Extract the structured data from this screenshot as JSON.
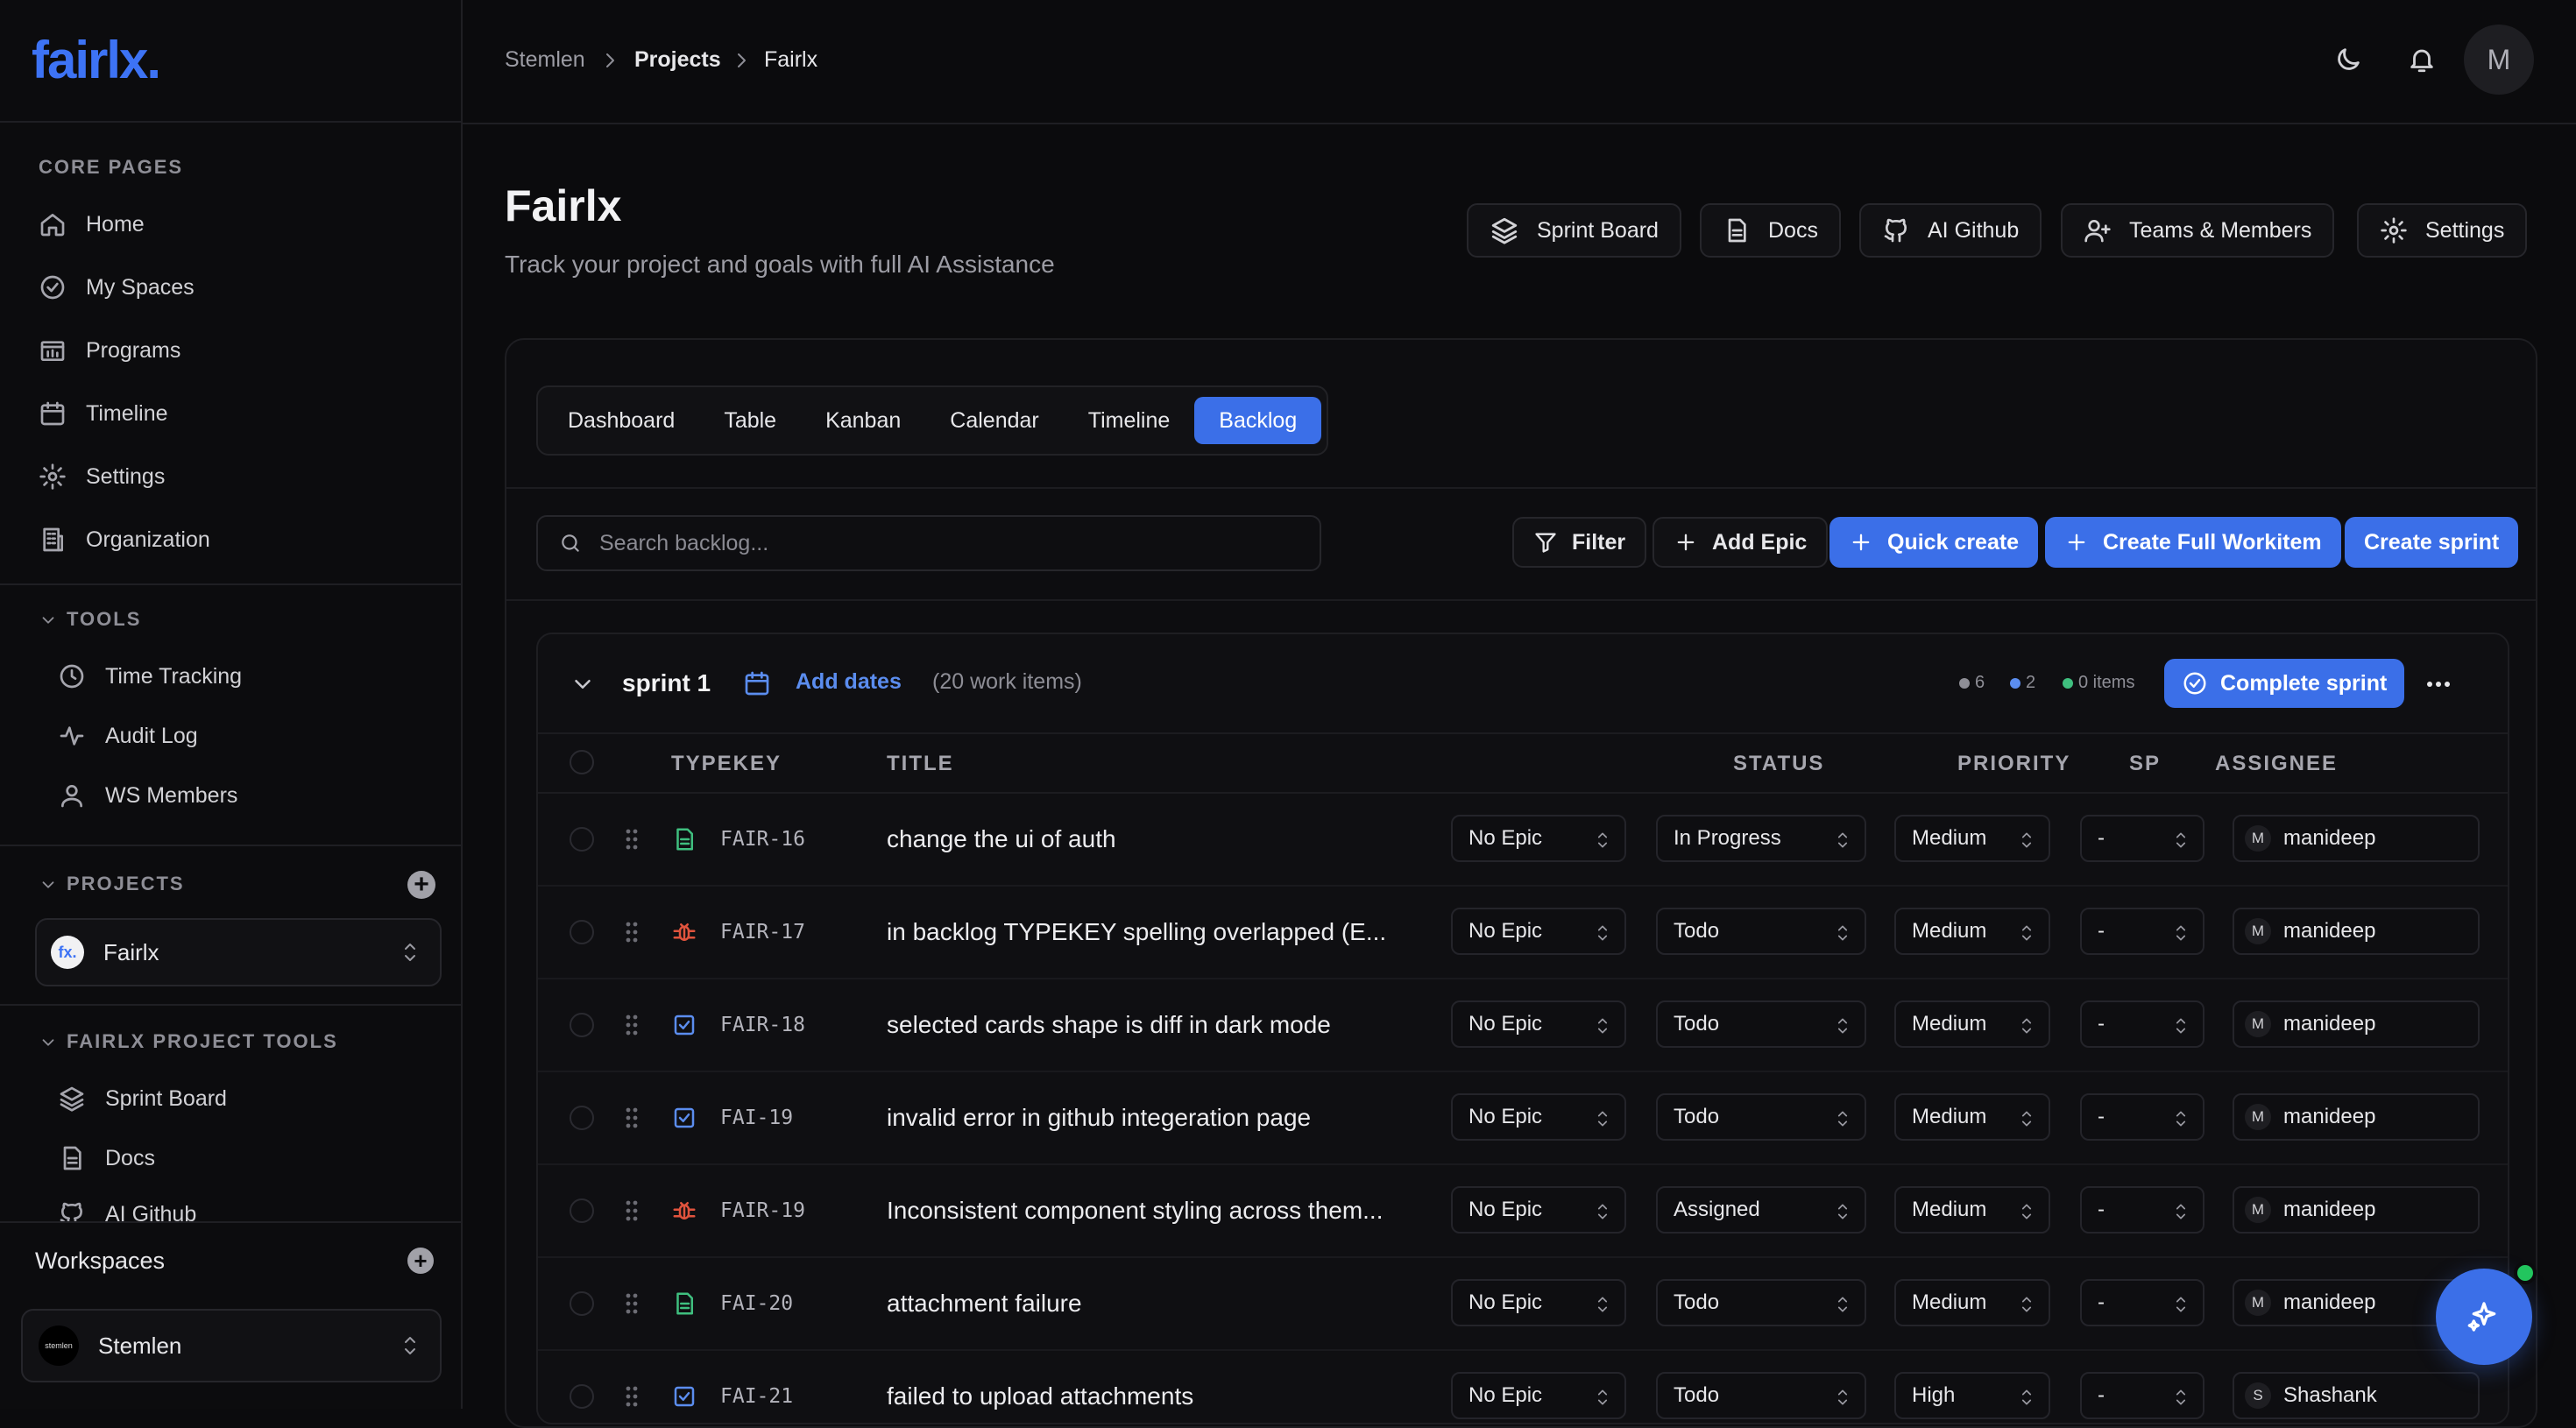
{
  "app": {
    "logo": "fairlx."
  },
  "breadcrumb": [
    "Stemlen",
    "Projects",
    "Fairlx"
  ],
  "avatar": "M",
  "sidebar": {
    "core_header": "CORE PAGES",
    "core": [
      "Home",
      "My Spaces",
      "Programs",
      "Timeline",
      "Settings",
      "Organization"
    ],
    "tools_header": "TOOLS",
    "tools": [
      "Time Tracking",
      "Audit Log",
      "WS Members"
    ],
    "projects_header": "PROJECTS",
    "project_selected": "Fairlx",
    "project_badge": "fx.",
    "project_tools_header": "FAIRLX PROJECT TOOLS",
    "project_tools": [
      "Sprint Board",
      "Docs",
      "AI Github"
    ],
    "workspaces_label": "Workspaces",
    "workspace_selected": "Stemlen",
    "workspace_badge": "stemlen"
  },
  "header": {
    "title": "Fairlx",
    "subtitle": "Track your project and goals with full AI Assistance",
    "buttons": [
      "Sprint Board",
      "Docs",
      "AI Github",
      "Teams & Members",
      "Settings"
    ]
  },
  "tabs": [
    "Dashboard",
    "Table",
    "Kanban",
    "Calendar",
    "Timeline",
    "Backlog"
  ],
  "active_tab": "Backlog",
  "toolbar": {
    "search_placeholder": "Search backlog...",
    "filter": "Filter",
    "add_epic": "Add Epic",
    "quick_create": "Quick create",
    "create_full": "Create Full Workitem",
    "create_sprint": "Create sprint"
  },
  "sprint": {
    "name": "sprint 1",
    "add_dates": "Add dates",
    "count": "(20 work items)",
    "stats": [
      {
        "value": "6",
        "color": "#8e8e96"
      },
      {
        "value": "2",
        "color": "#5b8def"
      },
      {
        "value": "0 items",
        "color": "#3fbf7f"
      }
    ],
    "complete": "Complete sprint"
  },
  "columns": {
    "typekey": "TYPEKEY",
    "title": "TITLE",
    "status": "STATUS",
    "priority": "PRIORITY",
    "sp": "SP",
    "assignee": "ASSIGNEE"
  },
  "rows": [
    {
      "type": "story",
      "key": "FAIR-16",
      "title": "change the ui of auth",
      "epic": "No Epic",
      "status": "In Progress",
      "priority": "Medium",
      "sp": "-",
      "assignee_initial": "M",
      "assignee": "manideep"
    },
    {
      "type": "bug",
      "key": "FAIR-17",
      "title": "in backlog TYPEKEY spelling overlapped (E...",
      "epic": "No Epic",
      "status": "Todo",
      "priority": "Medium",
      "sp": "-",
      "assignee_initial": "M",
      "assignee": "manideep"
    },
    {
      "type": "task",
      "key": "FAIR-18",
      "title": "selected cards shape is diff in dark mode",
      "epic": "No Epic",
      "status": "Todo",
      "priority": "Medium",
      "sp": "-",
      "assignee_initial": "M",
      "assignee": "manideep"
    },
    {
      "type": "task",
      "key": "FAI-19",
      "title": "invalid error in github integeration page",
      "epic": "No Epic",
      "status": "Todo",
      "priority": "Medium",
      "sp": "-",
      "assignee_initial": "M",
      "assignee": "manideep"
    },
    {
      "type": "bug",
      "key": "FAIR-19",
      "title": "Inconsistent component styling across them...",
      "epic": "No Epic",
      "status": "Assigned",
      "priority": "Medium",
      "sp": "-",
      "assignee_initial": "M",
      "assignee": "manideep"
    },
    {
      "type": "story",
      "key": "FAI-20",
      "title": "attachment failure",
      "epic": "No Epic",
      "status": "Todo",
      "priority": "Medium",
      "sp": "-",
      "assignee_initial": "M",
      "assignee": "manideep"
    },
    {
      "type": "task",
      "key": "FAI-21",
      "title": "failed to upload attachments",
      "epic": "No Epic",
      "status": "Todo",
      "priority": "High",
      "sp": "-",
      "assignee_initial": "S",
      "assignee": "Shashank"
    }
  ],
  "colors": {
    "accent": "#3b6fe8",
    "story": "#3fbf7f",
    "bug": "#e0533d",
    "task": "#5b8def"
  }
}
